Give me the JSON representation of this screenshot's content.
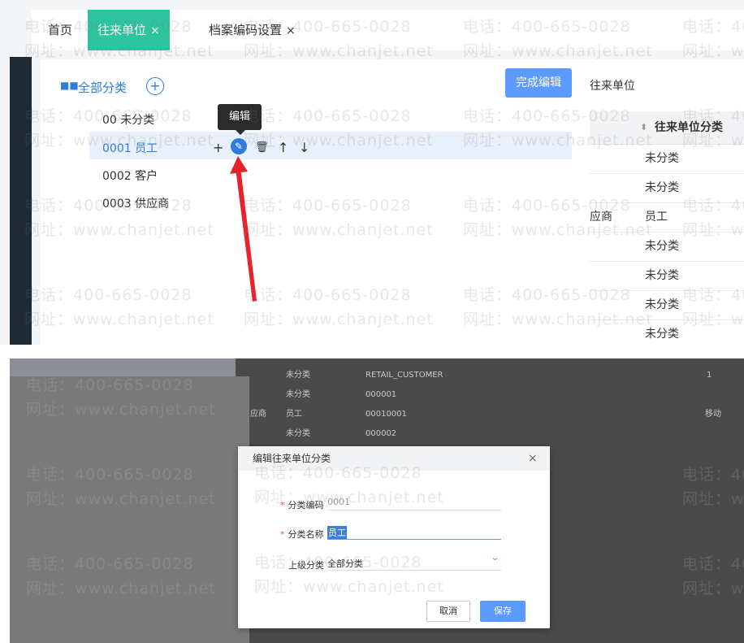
{
  "tabs": [
    {
      "label": "首页",
      "active": false,
      "closable": false
    },
    {
      "label": "往来单位",
      "active": true,
      "closable": true
    },
    {
      "label": "档案编码设置",
      "active": false,
      "closable": true
    }
  ],
  "tab_close_glyph": "×",
  "category_tree": {
    "root_label": "全部分类",
    "add_icon_glyph": "+",
    "items": [
      {
        "code_name": "00 未分类",
        "selected": false
      },
      {
        "code_name": "0001 员工",
        "selected": true
      },
      {
        "code_name": "0002 客户",
        "selected": false
      },
      {
        "code_name": "0003 供应商",
        "selected": false
      }
    ],
    "row_actions": {
      "add": "+",
      "edit": "✎",
      "delete": "🗑",
      "up": "↑",
      "down": "↓"
    },
    "tooltip": "编辑"
  },
  "toolbar": {
    "done_label": "完成编辑"
  },
  "right_table": {
    "title": "往来单位",
    "column_header": "往来单位分类",
    "sort_glyph": "⬍",
    "rows": [
      {
        "prefix": "",
        "category": "未分类"
      },
      {
        "prefix": "",
        "category": "未分类"
      },
      {
        "prefix": "应商",
        "category": "员工"
      },
      {
        "prefix": "",
        "category": "未分类"
      },
      {
        "prefix": "",
        "category": "未分类"
      },
      {
        "prefix": "",
        "category": "未分类"
      },
      {
        "prefix": "",
        "category": "未分类"
      }
    ]
  },
  "background_table": {
    "rows": [
      {
        "prefix": "",
        "category": "未分类",
        "code": "RETAIL_CUSTOMER",
        "extra": "1"
      },
      {
        "prefix": "",
        "category": "未分类",
        "code": "000001",
        "extra": ""
      },
      {
        "prefix": "应商",
        "category": "员工",
        "code": "00010001",
        "extra": "移动"
      },
      {
        "prefix": "",
        "category": "未分类",
        "code": "000002",
        "extra": ""
      }
    ]
  },
  "dialog": {
    "title": "编辑往来单位分类",
    "close_glyph": "×",
    "fields": {
      "code": {
        "label": "分类编码",
        "value": "0001",
        "required": true
      },
      "name": {
        "label": "分类名称",
        "value": "员工",
        "required": true
      },
      "parent": {
        "label": "上级分类",
        "value": "全部分类",
        "required": false
      }
    },
    "required_mark": "*",
    "cancel_label": "取消",
    "save_label": "保存"
  },
  "watermark": {
    "phone": "电话：400-665-0028",
    "site": "网址：www.chanjet.net"
  },
  "colors": {
    "accent_teal": "#2ec4a0",
    "primary_blue": "#5b9bff",
    "annotation_red": "#e8212a"
  }
}
